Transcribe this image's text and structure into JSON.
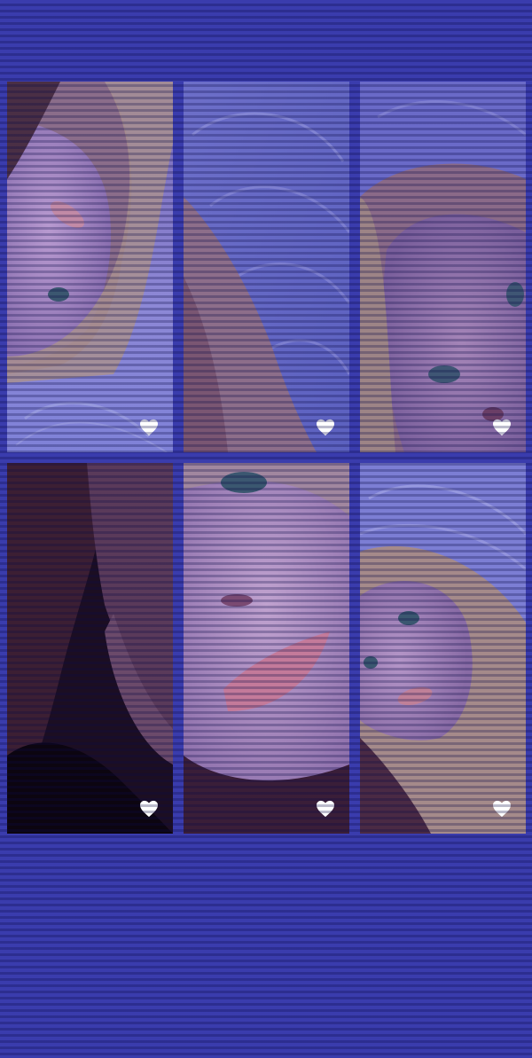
{
  "screen": {
    "background": "#3a3cad"
  },
  "gallery": {
    "items": [
      {
        "label": "photo-1",
        "icon": "heart-icon",
        "tint": "#8a78c9"
      },
      {
        "label": "photo-2",
        "icon": "heart-icon",
        "tint": "#6f6fd0"
      },
      {
        "label": "photo-3",
        "icon": "heart-icon",
        "tint": "#8a72b8"
      },
      {
        "label": "photo-4",
        "icon": "heart-icon",
        "tint": "#2a1430"
      },
      {
        "label": "photo-5",
        "icon": "heart-icon",
        "tint": "#a88ec8"
      },
      {
        "label": "photo-6",
        "icon": "heart-icon",
        "tint": "#8e80cc"
      }
    ]
  }
}
